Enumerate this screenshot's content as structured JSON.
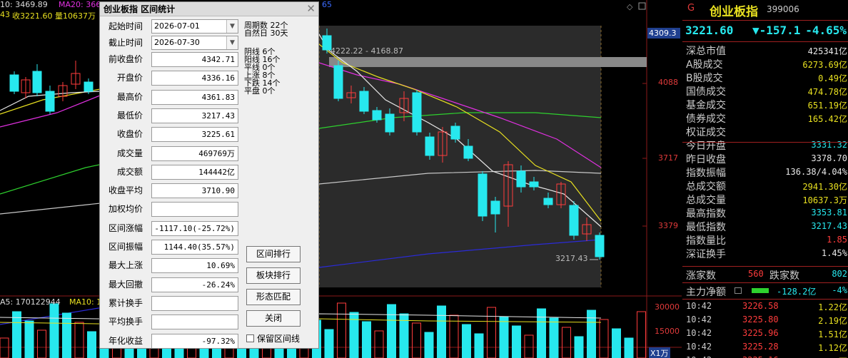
{
  "chart": {
    "ma_label_row": {
      "a": "10: 3469.89",
      "ma20": "MA20: 3668",
      "close_info": "收3221.60 量10637万"
    },
    "tag_left": "43",
    "top_right_num": "65",
    "price_tag": "4309.3",
    "axis_labels": [
      "4088",
      "3717",
      "3379"
    ],
    "range_label": "4222.22 - 4168.87",
    "low_label": "3217.43",
    "vol_label_row": {
      "ma5": "A5: 170122944",
      "ma10": "MA10: 1"
    },
    "vol_axis": [
      "30000",
      "15000"
    ],
    "vol_unit": "X1万",
    "colors": {
      "up": "#ff3c3c",
      "down": "#27e8ee",
      "ma5": "#e8e8e8",
      "ma10": "#e8e020",
      "ma20": "#e030e0",
      "ma60": "#2ed12e",
      "ma120": "#c8c8c8",
      "ma250": "#2b2bd8"
    }
  },
  "dialog": {
    "title": "创业板指 区间统计",
    "start_label": "起始时间",
    "start_value": "2026-07-01",
    "end_label": "截止时间",
    "end_value": "2026-07-30",
    "fields": [
      {
        "label": "前收盘价",
        "value": "4342.71"
      },
      {
        "label": "开盘价",
        "value": "4336.16"
      },
      {
        "label": "最高价",
        "value": "4361.83"
      },
      {
        "label": "最低价",
        "value": "3217.43"
      },
      {
        "label": "收盘价",
        "value": "3225.61"
      },
      {
        "label": "成交量",
        "value": "469769万"
      },
      {
        "label": "成交额",
        "value": "144442亿"
      },
      {
        "label": "收盘平均",
        "value": "3710.90"
      },
      {
        "label": "加权均价",
        "value": ""
      },
      {
        "label": "区间涨幅",
        "value": "-1117.10(-25.72%)"
      },
      {
        "label": "区间振幅",
        "value": "1144.40(35.57%)"
      },
      {
        "label": "最大上涨",
        "value": "10.69%"
      },
      {
        "label": "最大回撤",
        "value": "-26.24%"
      },
      {
        "label": "累计换手",
        "value": ""
      },
      {
        "label": "平均换手",
        "value": ""
      },
      {
        "label": "年化收益",
        "value": "-97.32%"
      }
    ],
    "stats": {
      "period_days": "周期数 22个",
      "natural_days": "自然日 30天",
      "yin": "阴线 6个",
      "yang": "阳线 16个",
      "flat_line": "平线 0个",
      "up": "上涨 8个",
      "down": "下跌 14个",
      "flat": "平盘 0个"
    },
    "buttons": {
      "rank": "区间排行",
      "sector_rank": "板块排行",
      "pattern": "形态匹配",
      "close": "关闭"
    },
    "keep_label": "保留区间线"
  },
  "quote": {
    "g": "G",
    "name": "创业板指",
    "code": "399006",
    "price": "3221.60",
    "change": "▼-157.1",
    "pct": "-4.65%",
    "rows": [
      {
        "label": "深总市值",
        "value": "425341亿",
        "color": "#e8e8e8"
      },
      {
        "label": "A股成交",
        "value": "6273.69亿",
        "color": "#e8e020"
      },
      {
        "label": "B股成交",
        "value": "0.49亿",
        "color": "#e8e020"
      },
      {
        "label": "国债成交",
        "value": "474.78亿",
        "color": "#e8e020"
      },
      {
        "label": "基金成交",
        "value": "651.19亿",
        "color": "#e8e020"
      },
      {
        "label": "债券成交",
        "value": "165.42亿",
        "color": "#e8e020"
      },
      {
        "label": "权证成交",
        "value": "",
        "color": "#e8e020"
      },
      {
        "label": "今日开盘",
        "value": "3331.32",
        "color": "#27e8ee"
      },
      {
        "label": "昨日收盘",
        "value": "3378.70",
        "color": "#e8e8e8"
      },
      {
        "label": "指数振幅",
        "value": "136.38/4.04%",
        "color": "#e8e8e8"
      },
      {
        "label": "总成交额",
        "value": "2941.30亿",
        "color": "#e8e020"
      },
      {
        "label": "总成交量",
        "value": "10637.3万",
        "color": "#e8e020"
      },
      {
        "label": "最高指数",
        "value": "3353.81",
        "color": "#27e8ee"
      },
      {
        "label": "最低指数",
        "value": "3217.43",
        "color": "#27e8ee"
      },
      {
        "label": "指数量比",
        "value": "1.85",
        "color": "#ff3c3c"
      },
      {
        "label": "深证换手",
        "value": "1.45%",
        "color": "#e8e8e8"
      }
    ],
    "up_label": "涨家数",
    "up_count": "560",
    "down_label": "跌家数",
    "down_count": "802",
    "main_label": "主力净额",
    "main_value": "-128.2亿",
    "main_pct": "-4%",
    "ticks": [
      {
        "time": "10:42",
        "price": "3226.58",
        "vol": "1.22亿"
      },
      {
        "time": "10:42",
        "price": "3225.80",
        "vol": "2.19亿"
      },
      {
        "time": "10:42",
        "price": "3225.96",
        "vol": "1.51亿"
      },
      {
        "time": "10:42",
        "price": "3225.28",
        "vol": "1.12亿"
      },
      {
        "time": "10:42",
        "price": "3225.16",
        "vol": "8989万"
      }
    ]
  }
}
